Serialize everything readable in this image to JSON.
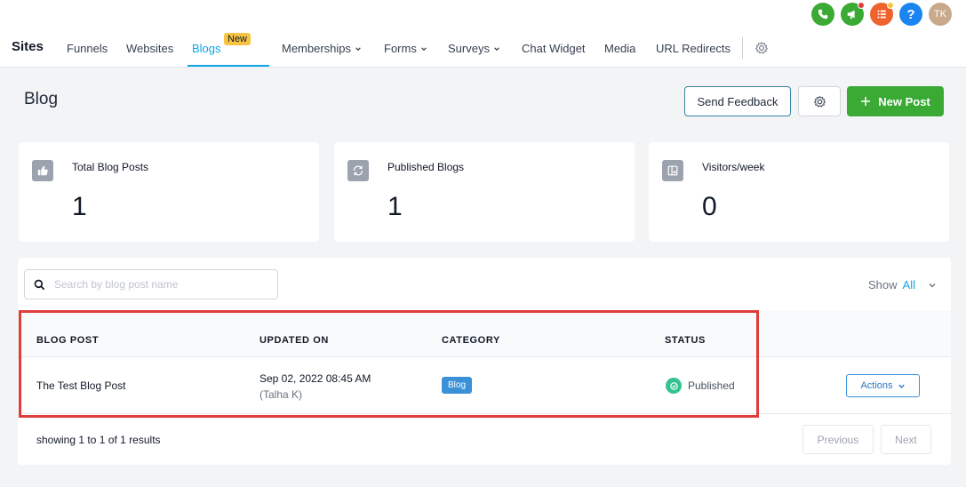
{
  "colors": {
    "accent": "#0ea5e9",
    "primary_button": "#3aaa35",
    "highlight_box": "#e03c3c",
    "status_published": "#34c38f",
    "category_badge": "#3b91d8",
    "new_badge": "#f6c343"
  },
  "top_icons": [
    {
      "name": "phone-icon",
      "color": "#3aaa35"
    },
    {
      "name": "megaphone-icon",
      "color": "#3aaa35",
      "dot_color": "#e03c3c"
    },
    {
      "name": "list-icon",
      "color": "#f0622d",
      "dot_color": "#f6c343"
    },
    {
      "name": "help-icon",
      "color": "#1a84f0",
      "label": "?"
    },
    {
      "name": "avatar",
      "color": "#c9a98b",
      "label": "TK"
    }
  ],
  "nav": {
    "sites": "Sites",
    "items": {
      "funnels": "Funnels",
      "websites": "Websites",
      "blogs": "Blogs",
      "blogs_badge": "New",
      "memberships": "Memberships",
      "forms": "Forms",
      "surveys": "Surveys",
      "chat_widget": "Chat Widget",
      "media": "Media",
      "url_redirects": "URL Redirects"
    }
  },
  "header": {
    "title": "Blog",
    "send_feedback": "Send Feedback",
    "new_post": "New Post"
  },
  "stats": [
    {
      "label": "Total Blog Posts",
      "value": "1",
      "icon": "thumbs-up-icon"
    },
    {
      "label": "Published Blogs",
      "value": "1",
      "icon": "refresh-icon"
    },
    {
      "label": "Visitors/week",
      "value": "0",
      "icon": "visitor-icon"
    }
  ],
  "table": {
    "search_placeholder": "Search by blog post name",
    "show_label": "Show",
    "show_value": "All",
    "columns": [
      "BLOG POST",
      "UPDATED ON",
      "CATEGORY",
      "STATUS"
    ],
    "rows": [
      {
        "title": "The Test Blog Post",
        "updated": "Sep 02, 2022 08:45 AM",
        "updated_by": "(Talha K)",
        "category": "Blog",
        "status": "Published",
        "actions": "Actions"
      }
    ],
    "footer": {
      "showing": "showing",
      "from": "1",
      "to_word": "to",
      "to": "1",
      "of_word": "of",
      "total": "1",
      "results": "results"
    },
    "pagination": {
      "previous": "Previous",
      "next": "Next"
    }
  }
}
